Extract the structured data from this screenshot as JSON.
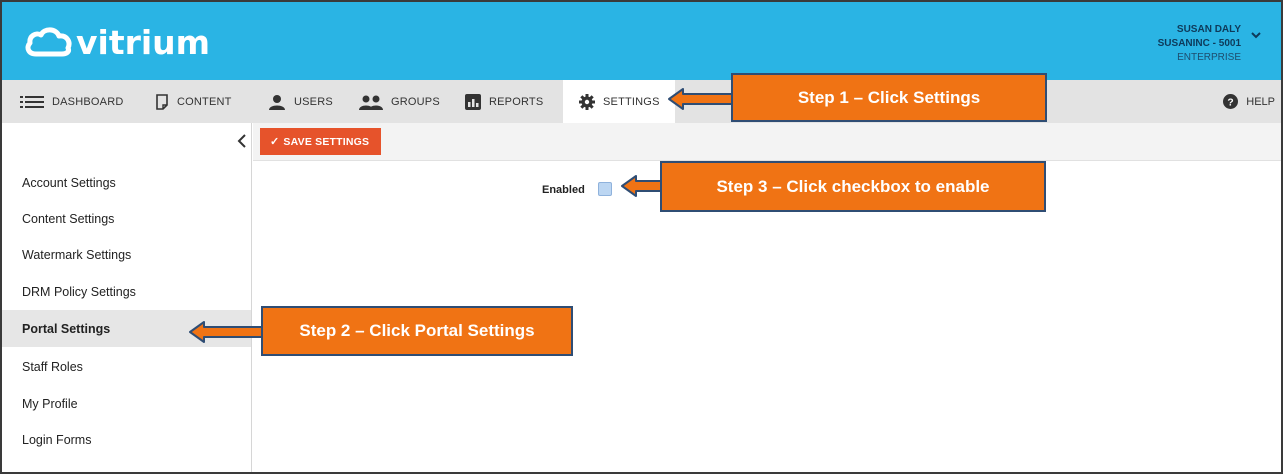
{
  "header": {
    "logo_text": "vitrium",
    "user_name": "SUSAN DALY",
    "account": "SUSANINC - 5001",
    "tier": "ENTERPRISE"
  },
  "nav": {
    "items": [
      {
        "label": "DASHBOARD",
        "icon": "list-icon"
      },
      {
        "label": "CONTENT",
        "icon": "document-icon"
      },
      {
        "label": "USERS",
        "icon": "user-icon"
      },
      {
        "label": "GROUPS",
        "icon": "group-icon"
      },
      {
        "label": "REPORTS",
        "icon": "bar-chart-icon"
      },
      {
        "label": "SETTINGS",
        "icon": "gear-icon",
        "active": true
      }
    ],
    "help_label": "HELP"
  },
  "sidebar": {
    "items": [
      {
        "label": "Account Settings"
      },
      {
        "label": "Content Settings"
      },
      {
        "label": "Watermark Settings"
      },
      {
        "label": "DRM Policy Settings"
      },
      {
        "label": "Portal Settings",
        "active": true
      },
      {
        "label": "Staff Roles"
      },
      {
        "label": "My Profile"
      },
      {
        "label": "Login Forms"
      }
    ]
  },
  "toolbar": {
    "save_label": "SAVE SETTINGS"
  },
  "form": {
    "enabled_label": "Enabled",
    "enabled_checked": false
  },
  "annotations": {
    "step1": "Step 1 – Click Settings",
    "step2": "Step 2 – Click Portal Settings",
    "step3": "Step 3 – Click checkbox to enable"
  },
  "colors": {
    "header_bg": "#2ab4e4",
    "accent_button": "#e6532b",
    "callout_fill": "#f07314",
    "callout_border": "#2f4d74"
  }
}
